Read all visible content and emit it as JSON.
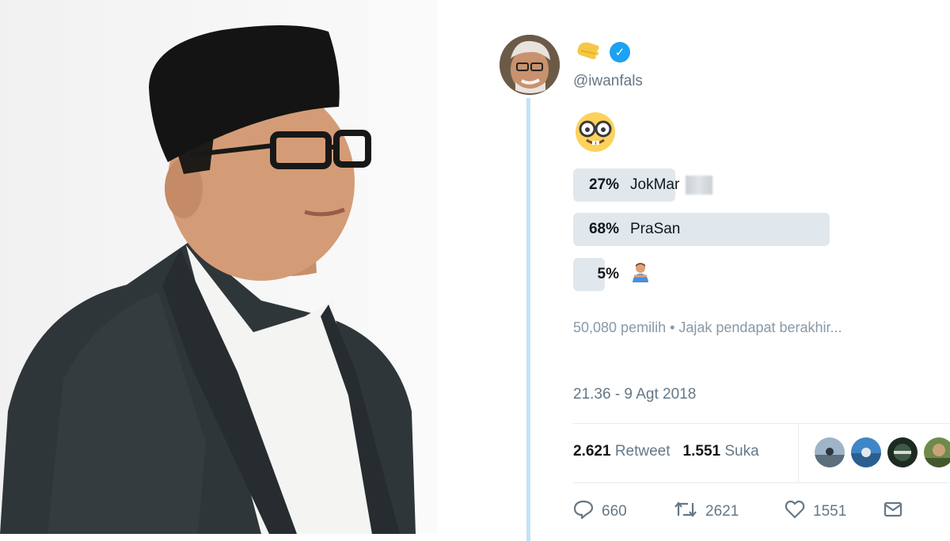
{
  "tweet": {
    "handle": "@iwanfals",
    "poll": [
      {
        "percent": "27%",
        "label": "JokMar",
        "fraction": 0.27
      },
      {
        "percent": "68%",
        "label": "PraSan",
        "fraction": 0.68
      },
      {
        "percent": "5%",
        "label": "",
        "fraction": 0.05
      }
    ],
    "meta": "50,080 pemilih • Jajak pendapat berakhir...",
    "timestamp": "21.36 - 9 Agt 2018",
    "stats": {
      "retweet_count": "2.621",
      "retweet_label": "Retweet",
      "like_count": "1.551",
      "like_label": "Suka"
    },
    "actions": {
      "reply": "660",
      "retweet": "2621",
      "like": "1551"
    }
  },
  "colors": {
    "accent": "#1da1f2",
    "thread_line": "#c2e3f7",
    "poll_bar": "#e1e8ed",
    "muted_text": "#657786"
  },
  "icons": [
    "clapping-hands-icon",
    "verified-badge-icon",
    "nerd-face-emoji",
    "person-gesture-emoji",
    "reply-icon",
    "retweet-icon",
    "heart-icon",
    "message-icon"
  ]
}
